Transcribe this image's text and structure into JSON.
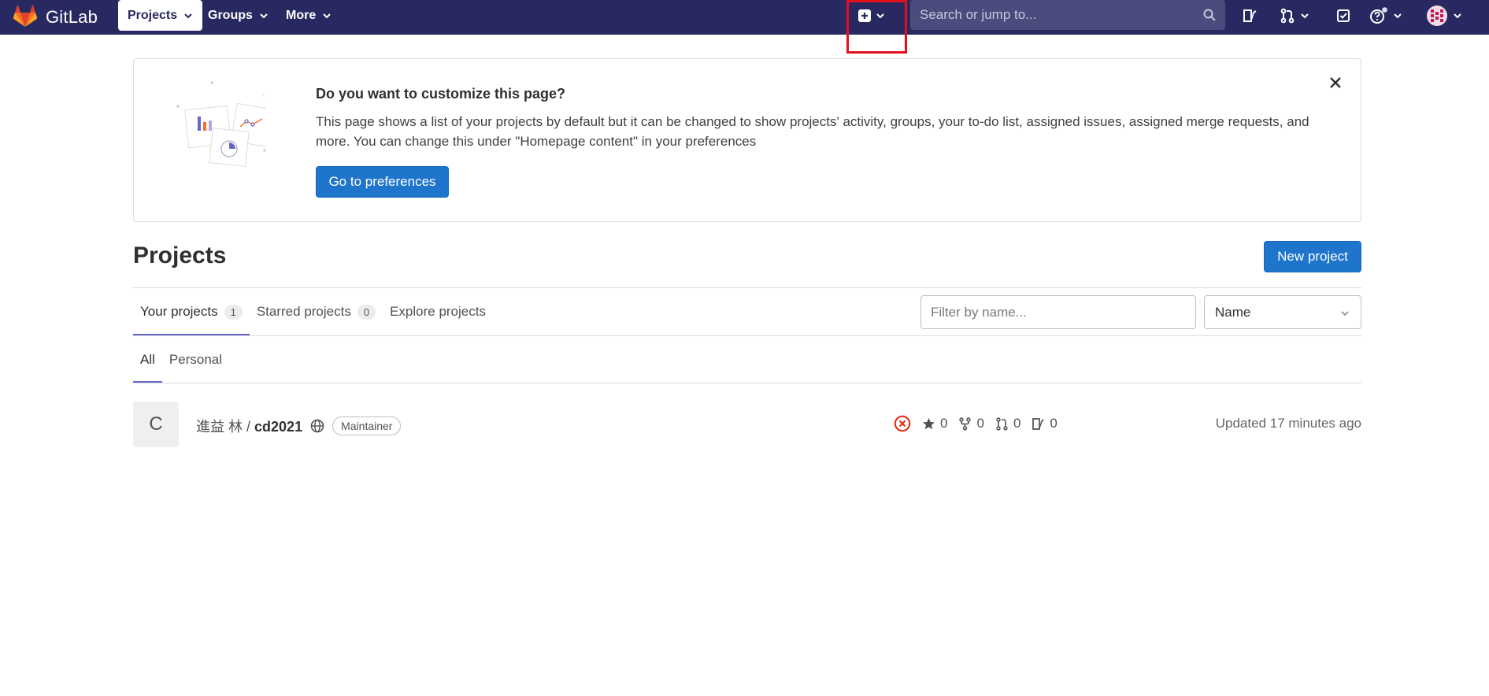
{
  "navbar": {
    "brand": "GitLab",
    "menus": [
      {
        "label": "Projects"
      },
      {
        "label": "Groups"
      },
      {
        "label": "More"
      }
    ],
    "search_placeholder": "Search or jump to...",
    "icons": [
      "new-dropdown-icon",
      "search-icon",
      "issues-icon",
      "merge-requests-icon",
      "todos-icon",
      "help-icon",
      "user-avatar-icon"
    ],
    "bg_color": "#292961"
  },
  "callout": {
    "title": "Do you want to customize this page?",
    "body": "This page shows a list of your projects by default but it can be changed to show projects' activity, groups, your to-do list, assigned issues, assigned merge requests, and more. You can change this under \"Homepage content\" in your preferences",
    "button": "Go to preferences"
  },
  "header": {
    "title": "Projects",
    "new_project": "New project"
  },
  "tabs": [
    {
      "label": "Your projects",
      "count": "1"
    },
    {
      "label": "Starred projects",
      "count": "0"
    },
    {
      "label": "Explore projects"
    }
  ],
  "filter": {
    "placeholder": "Filter by name...",
    "sort_value": "Name"
  },
  "subtabs": [
    "All",
    "Personal"
  ],
  "projects": [
    {
      "avatar_letter": "C",
      "namespace": "進益 林 /",
      "name": "cd2021",
      "role": "Maintainer",
      "stars": "0",
      "forks": "0",
      "merge_requests": "0",
      "issues": "0",
      "updated": "Updated 17 minutes ago"
    }
  ],
  "colors": {
    "primary": "#1f75cb",
    "accent_tab": "#6666c4",
    "pipeline_failed": "#dd2b0e"
  }
}
